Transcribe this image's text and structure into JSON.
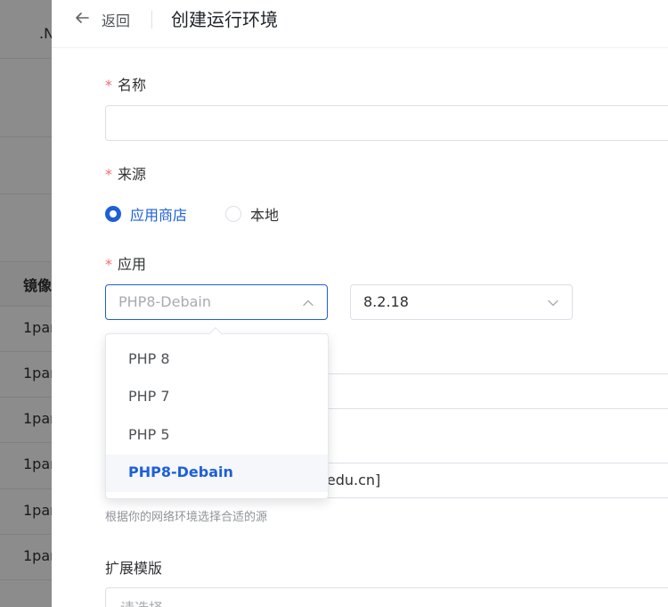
{
  "background": {
    "header_fragment": ".N",
    "column_header_fragment": "镜像",
    "row_fragments": [
      "1par",
      "1par",
      "1par",
      "1par",
      "1par",
      "1par"
    ]
  },
  "drawer": {
    "back_label": "返回",
    "title": "创建运行环境"
  },
  "form": {
    "name": {
      "label": "名称",
      "value": ""
    },
    "source": {
      "label": "来源",
      "options": [
        "应用商店",
        "本地"
      ],
      "selected": "应用商店"
    },
    "app": {
      "label": "应用",
      "selected_app": "PHP8-Debain",
      "selected_version": "8.2.18"
    },
    "mirror": {
      "value_fragment": "c.edu.cn]",
      "hint": "根据你的网络环境选择合适的源"
    },
    "extension": {
      "label": "扩展模版",
      "placeholder": "请选择"
    }
  },
  "dropdown": {
    "options": [
      "PHP 8",
      "PHP 7",
      "PHP 5",
      "PHP8-Debain"
    ],
    "selected_index": 3
  },
  "colors": {
    "accent": "#1e5fd9",
    "required": "#f56c6c"
  }
}
